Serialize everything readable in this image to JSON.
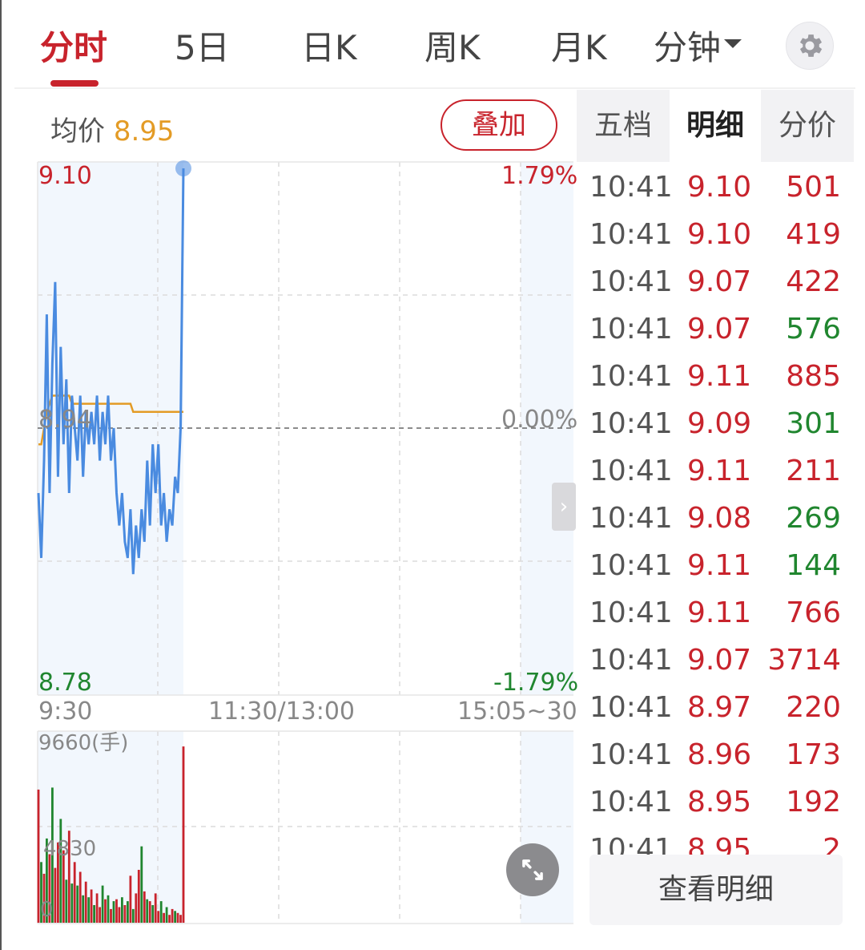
{
  "tabs": [
    {
      "label": "分时",
      "active": true
    },
    {
      "label": "5日"
    },
    {
      "label": "日K"
    },
    {
      "label": "周K"
    },
    {
      "label": "月K"
    },
    {
      "label": "分钟"
    }
  ],
  "avg_price": {
    "label": "均价",
    "value": "8.95"
  },
  "overlay_label": "叠加",
  "right_tabs": [
    {
      "label": "五档"
    },
    {
      "label": "明细",
      "active": true
    },
    {
      "label": "分价"
    }
  ],
  "price_axis": {
    "top": "9.10",
    "mid": "8.94",
    "bottom": "8.78"
  },
  "pct_axis": {
    "top": "1.79%",
    "mid": "0.00%",
    "bottom": "-1.79%"
  },
  "time_axis": {
    "start": "9:30",
    "mid": "11:30/13:00",
    "end": "15:05~30"
  },
  "volume_axis": {
    "top": "9660(手)",
    "mid": "4830",
    "bottom": "0"
  },
  "ticks": [
    {
      "time": "10:41",
      "price": "9.10",
      "volume": "501",
      "dir": "up"
    },
    {
      "time": "10:41",
      "price": "9.10",
      "volume": "419",
      "dir": "up"
    },
    {
      "time": "10:41",
      "price": "9.07",
      "volume": "422",
      "dir": "up"
    },
    {
      "time": "10:41",
      "price": "9.07",
      "volume": "576",
      "dir": "down"
    },
    {
      "time": "10:41",
      "price": "9.11",
      "volume": "885",
      "dir": "up"
    },
    {
      "time": "10:41",
      "price": "9.09",
      "volume": "301",
      "dir": "down"
    },
    {
      "time": "10:41",
      "price": "9.11",
      "volume": "211",
      "dir": "up"
    },
    {
      "time": "10:41",
      "price": "9.08",
      "volume": "269",
      "dir": "down"
    },
    {
      "time": "10:41",
      "price": "9.11",
      "volume": "144",
      "dir": "down"
    },
    {
      "time": "10:41",
      "price": "9.11",
      "volume": "766",
      "dir": "up"
    },
    {
      "time": "10:41",
      "price": "9.07",
      "volume": "3714",
      "dir": "up"
    },
    {
      "time": "10:41",
      "price": "8.97",
      "volume": "220",
      "dir": "up"
    },
    {
      "time": "10:41",
      "price": "8.96",
      "volume": "173",
      "dir": "up"
    },
    {
      "time": "10:41",
      "price": "8.95",
      "volume": "192",
      "dir": "up"
    },
    {
      "time": "10:41",
      "price": "8.95",
      "volume": "2",
      "dir": "up"
    }
  ],
  "detail_button_label": "查看明细",
  "colors": {
    "up": "#c8232c",
    "down": "#20862f",
    "price_line": "#4a8be0",
    "avg_line": "#e39b25"
  },
  "chart_data": {
    "type": "line",
    "price_range": [
      8.78,
      9.1
    ],
    "prev_close": 8.94,
    "price_series": [
      8.9,
      8.86,
      8.92,
      9.01,
      8.9,
      8.98,
      9.03,
      8.91,
      8.99,
      8.93,
      8.97,
      8.9,
      8.96,
      8.94,
      8.92,
      8.96,
      8.91,
      8.95,
      8.93,
      8.95,
      8.93,
      8.96,
      8.92,
      8.95,
      8.93,
      8.96,
      8.92,
      8.94,
      8.9,
      8.88,
      8.9,
      8.87,
      8.86,
      8.89,
      8.85,
      8.88,
      8.86,
      8.89,
      8.87,
      8.92,
      8.88,
      8.93,
      8.9,
      8.93,
      8.88,
      8.9,
      8.87,
      8.89,
      8.88,
      8.91,
      8.9,
      8.94,
      9.1
    ],
    "avg_series": [
      8.93,
      8.93,
      8.94,
      8.95,
      8.955,
      8.96,
      8.96,
      8.96,
      8.96,
      8.96,
      8.96,
      8.96,
      8.955,
      8.955,
      8.955,
      8.955,
      8.955,
      8.955,
      8.955,
      8.955,
      8.955,
      8.955,
      8.955,
      8.955,
      8.955,
      8.955,
      8.955,
      8.955,
      8.955,
      8.955,
      8.955,
      8.955,
      8.955,
      8.955,
      8.95,
      8.95,
      8.95,
      8.95,
      8.95,
      8.95,
      8.95,
      8.95,
      8.95,
      8.95,
      8.95,
      8.95,
      8.95,
      8.95,
      8.95,
      8.95,
      8.95,
      8.95,
      8.95
    ],
    "volume_max": 9660,
    "volumes": [
      6800,
      3100,
      2500,
      4300,
      3500,
      6900,
      2800,
      4100,
      5300,
      3700,
      2200,
      4700,
      2000,
      3100,
      1900,
      2600,
      1400,
      2100,
      1300,
      1700,
      900,
      1500,
      800,
      1900,
      1200,
      1400,
      700,
      1100,
      1200,
      800,
      1300,
      900,
      1100,
      2400,
      700,
      1500,
      2700,
      3900,
      1600,
      1200,
      1100,
      900,
      1500,
      600,
      1100,
      500,
      800,
      400,
      700,
      600,
      500,
      400,
      9000
    ],
    "volume_dir": [
      "up",
      "down",
      "up",
      "down",
      "up",
      "down",
      "up",
      "up",
      "down",
      "up",
      "down",
      "up",
      "down",
      "up",
      "down",
      "up",
      "down",
      "up",
      "down",
      "up",
      "down",
      "up",
      "up",
      "down",
      "up",
      "down",
      "up",
      "down",
      "up",
      "up",
      "down",
      "up",
      "down",
      "up",
      "down",
      "up",
      "up",
      "down",
      "up",
      "down",
      "up",
      "down",
      "up",
      "up",
      "down",
      "up",
      "down",
      "up",
      "up",
      "down",
      "up",
      "up",
      "up"
    ]
  }
}
